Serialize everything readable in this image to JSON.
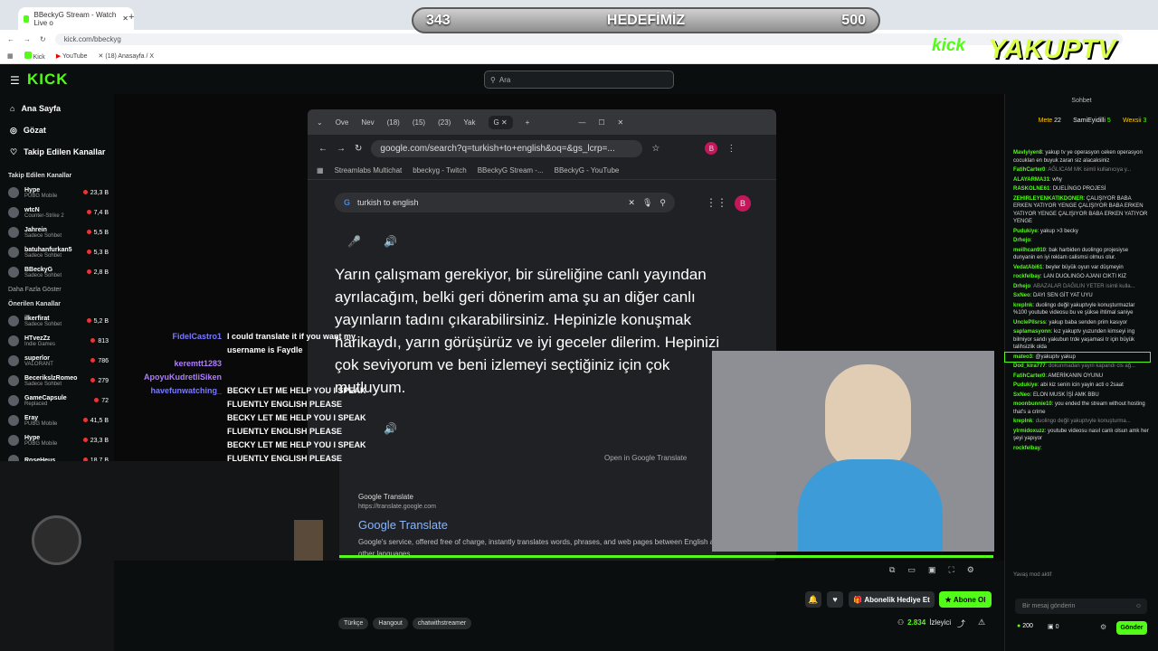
{
  "browser": {
    "tabs": [
      {
        "label": "BBeckyG Stream - Watch Live o"
      },
      {
        "label": "+"
      }
    ],
    "url": "kick.com/bbeckyg",
    "bookmarks": [
      "Kick",
      "YouTube",
      "(18) Anasayfa / X"
    ]
  },
  "goal": {
    "current": "343",
    "label": "HEDEFİMİZ",
    "target": "500"
  },
  "overlay_logo": {
    "text1": "kick",
    "text2": "YAKUPTV"
  },
  "kick": {
    "logo": "KICK",
    "search_placeholder": "Ara",
    "nav": [
      {
        "label": "Ana Sayfa",
        "icon": "home-icon"
      },
      {
        "label": "Gözat",
        "icon": "compass-icon"
      },
      {
        "label": "Takip Edilen Kanallar",
        "icon": "heart-icon"
      }
    ],
    "followed_title": "Takip Edilen Kanallar",
    "followed": [
      {
        "name": "Hype",
        "sub": "PUBG Mobile",
        "viewers": "23,3 B"
      },
      {
        "name": "wtcN",
        "sub": "Counter-Strike 2",
        "viewers": "7,4 B"
      },
      {
        "name": "Jahrein",
        "sub": "Sadece Sohbet",
        "viewers": "5,5 B"
      },
      {
        "name": "batuhanfurkan5",
        "sub": "Sadece Sohbet",
        "viewers": "5,3 B"
      },
      {
        "name": "BBeckyG",
        "sub": "Sadece Sohbet",
        "viewers": "2,8 B"
      }
    ],
    "show_more": "Daha Fazla Göster",
    "recommended_title": "Önerilen Kanallar",
    "recommended": [
      {
        "name": "ilkerfirat",
        "sub": "Sadece Sohbet",
        "viewers": "5,2 B"
      },
      {
        "name": "HTvezZz",
        "sub": "Indie Games",
        "viewers": "813"
      },
      {
        "name": "superlor",
        "sub": "VALORANT",
        "viewers": "786"
      },
      {
        "name": "BecerikslzRomeo",
        "sub": "Sadece Sohbet",
        "viewers": "279"
      },
      {
        "name": "GameCapsule",
        "sub": "Replaced",
        "viewers": "72"
      },
      {
        "name": "Eray",
        "sub": "PUBG Mobile",
        "viewers": "41,5 B"
      },
      {
        "name": "Hype",
        "sub": "PUBG Mobile",
        "viewers": "23,3 B"
      },
      {
        "name": "RoseHeus",
        "sub": "",
        "viewers": "18,7 B"
      }
    ]
  },
  "google": {
    "tabs": [
      "Ove",
      "Nev",
      "(18)",
      "(15)",
      "(23)",
      "Yak"
    ],
    "url": "google.com/search?q=turkish+to+english&oq=&gs_lcrp=...",
    "bookmarks": [
      "Streamlabs Multichat",
      "bbeckyg - Twitch",
      "BBeckyG Stream -...",
      "BBeckyG - YouTube"
    ],
    "search": "turkish to english",
    "avatar": "B",
    "translation": "Yarın çalışmam gerekiyor, bir süreliğine canlı yayından ayrılacağım, belki geri dönerim ama şu an diğer canlı yayınların tadını çıkarabilirsiniz. Hepinizle konuşmak harikaydı, yarın görüşürüz ve iyi geceler dilerim. Hepinizi çok seviyorum ve beni izlemeyi seçtiğiniz için çok mutluyum.",
    "open_in": "Open in Google Translate",
    "result_source": "Google Translate",
    "result_url": "https://translate.google.com",
    "result_title": "Google Translate",
    "result_desc": "Google's service, offered free of charge, instantly translates words, phrases, and web pages between English and over 100 other languages."
  },
  "stream_chat_overlay": [
    {
      "user": "FidelCastro1",
      "text": "I could translate it if you want my username is Faydle",
      "color": "#7a7aff"
    },
    {
      "user": "keremtt1283",
      "text": "",
      "color": "#b07cff"
    },
    {
      "user": "ApoyuKudretliSiken",
      "text": "",
      "color": "#b07cff"
    },
    {
      "user": "havefunwatching_",
      "text": "BECKY LET ME HELP YOU I SPEAK FLUENTLY ENGLISH PLEASE",
      "color": "#7a7aff"
    },
    {
      "user": "",
      "text": "BECKY LET ME HELP YOU I SPEAK FLUENTLY ENGLISH PLEASE",
      "color": "#fff"
    },
    {
      "user": "",
      "text": "BECKY LET ME HELP YOU I SPEAK FLUENTLY ENGLISH PLEASE",
      "color": "#fff"
    }
  ],
  "player": {
    "tags": [
      "Türkçe",
      "Hangout",
      "chatwithstreamer"
    ],
    "gift_sub": "Abonelik Hediye Et",
    "subscribe": "Abone Ol",
    "viewers": "2.834",
    "viewers_label": "İzleyici"
  },
  "chat": {
    "title": "Sohbet",
    "leaders": [
      {
        "name": "Mete",
        "count": "22"
      },
      {
        "name": "SamiEyidilli",
        "count": "5"
      },
      {
        "name": "Wexsii",
        "count": "3"
      }
    ],
    "messages": [
      {
        "user": "Mavlyiyen8",
        "text": "yakup tv ye operasyon ceken operasyon cocuklan en buyuk zaran siz alacaksiniz"
      },
      {
        "user": "FatihCarter0",
        "text": "AĞLICAM MK isimli kullanıcıya y...",
        "sys": true
      },
      {
        "user": "ALAYARMA31",
        "text": "why"
      },
      {
        "user": "RASKOLNE61",
        "text": "DUELİNGO PROJESİ"
      },
      {
        "user": "ZEHIRLEYENKATIKDONER",
        "text": "ÇALIŞIYOR BABA ERKEN YATIYOR YENGE ÇALIŞIYOR BABA ERKEN YATIYOR YENGE ÇALIŞIYOR BABA ERKEN YATIYOR YENGE"
      },
      {
        "user": "Pudukiye",
        "text": "yakup >3 becky"
      },
      {
        "user": "Drhejo",
        "text": ""
      },
      {
        "user": "meilhcan910",
        "text": "bak harbiden duolingo projesiyse dunyanin en iyi reklam calismsi olmus olur."
      },
      {
        "user": "VedatAbi61",
        "text": "beyler büyük oyun var düşmeyin"
      },
      {
        "user": "rockfelbay",
        "text": "LAN DUOLINGO AJANI CIKTI KIZ"
      },
      {
        "user": "Drhejo",
        "text": "ABAZALAR DAĞILIN YETER isimli kulla...",
        "sys": true
      },
      {
        "user": "SxNeo",
        "text": "DAYI SEN GİT YAT UYU"
      },
      {
        "user": "kreplnk",
        "text": "duolingo değil yakuptvyle konuşturmazlar %100 youtube videosu bu ve şükse ihtimal saniye"
      },
      {
        "user": "UnclePllsrss",
        "text": "yakup baba senden prim kasıyor"
      },
      {
        "user": "saplamasyonn",
        "text": "kız yakuptv yuzunden kimseyi ing bilmiyor sandı yakubun trde yaşamasi tr için büyük talihsizlik olda"
      },
      {
        "user": "mateo3",
        "text": "@yakuptv yakup",
        "hl": true
      },
      {
        "user": "Dod_kira777",
        "text": "dokunmadan yayın kapandı cls ağ...",
        "sys": true
      },
      {
        "user": "FatihCarter0",
        "text": "AMERİKANIN OYUNU"
      },
      {
        "user": "Pudukiye",
        "text": "abi kiz senin icin yayin acti o 2saat"
      },
      {
        "user": "SxNeo",
        "text": "ELON MUSK İŞİ AMK BBU"
      },
      {
        "user": "moonbunnie10",
        "text": "you ended the stream without hosting that's a crime"
      },
      {
        "user": "kreplnk",
        "text": "duolingo değil yakuptvyle konuşturma...",
        "sys": true
      },
      {
        "user": "ylrmidoxuzz",
        "text": "youtube videosu nasıl canlı olsun amk her şeyi yapıyor"
      },
      {
        "user": "rockfelbay",
        "text": ""
      }
    ],
    "slow_mode": "Yavaş mod aktif",
    "input_placeholder": "Bir mesaj gönderin",
    "points": "200",
    "redeem_count": "0",
    "send": "Gönder"
  },
  "colors": {
    "accent": "#53fc18",
    "bg": "#0b0e0f"
  }
}
